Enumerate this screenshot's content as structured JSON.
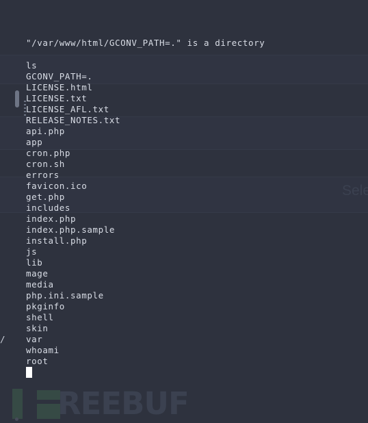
{
  "terminal": {
    "header_message": "\"/var/www/html/GCONV_PATH=.\" is a directory",
    "output_lines": [
      "ls",
      "GCONV_PATH=.",
      "LICENSE.html",
      "LICENSE.txt",
      "LICENSE_AFL.txt",
      "RELEASE_NOTES.txt",
      "api.php",
      "app",
      "cron.php",
      "cron.sh",
      "errors",
      "favicon.ico",
      "get.php",
      "includes",
      "index.php",
      "index.php.sample",
      "install.php",
      "js",
      "lib",
      "mage",
      "media",
      "php.ini.sample",
      "pkginfo",
      "shell",
      "skin",
      "var",
      "whoami",
      "root"
    ],
    "gutter_glyph": "/",
    "cursor": "block",
    "colors": {
      "background": "#2e323e",
      "text": "#d9dde6",
      "rule": "#353a48",
      "cursor": "#ffffff",
      "scrollbar": "#6e7585"
    }
  },
  "overlay": {
    "ghost_label": "Sele",
    "watermark_text": "REEBUF",
    "watermark_mark": "freebuf-f-logo",
    "watermark_color": "#3b4150",
    "watermark_mark_color": "#364a45"
  }
}
